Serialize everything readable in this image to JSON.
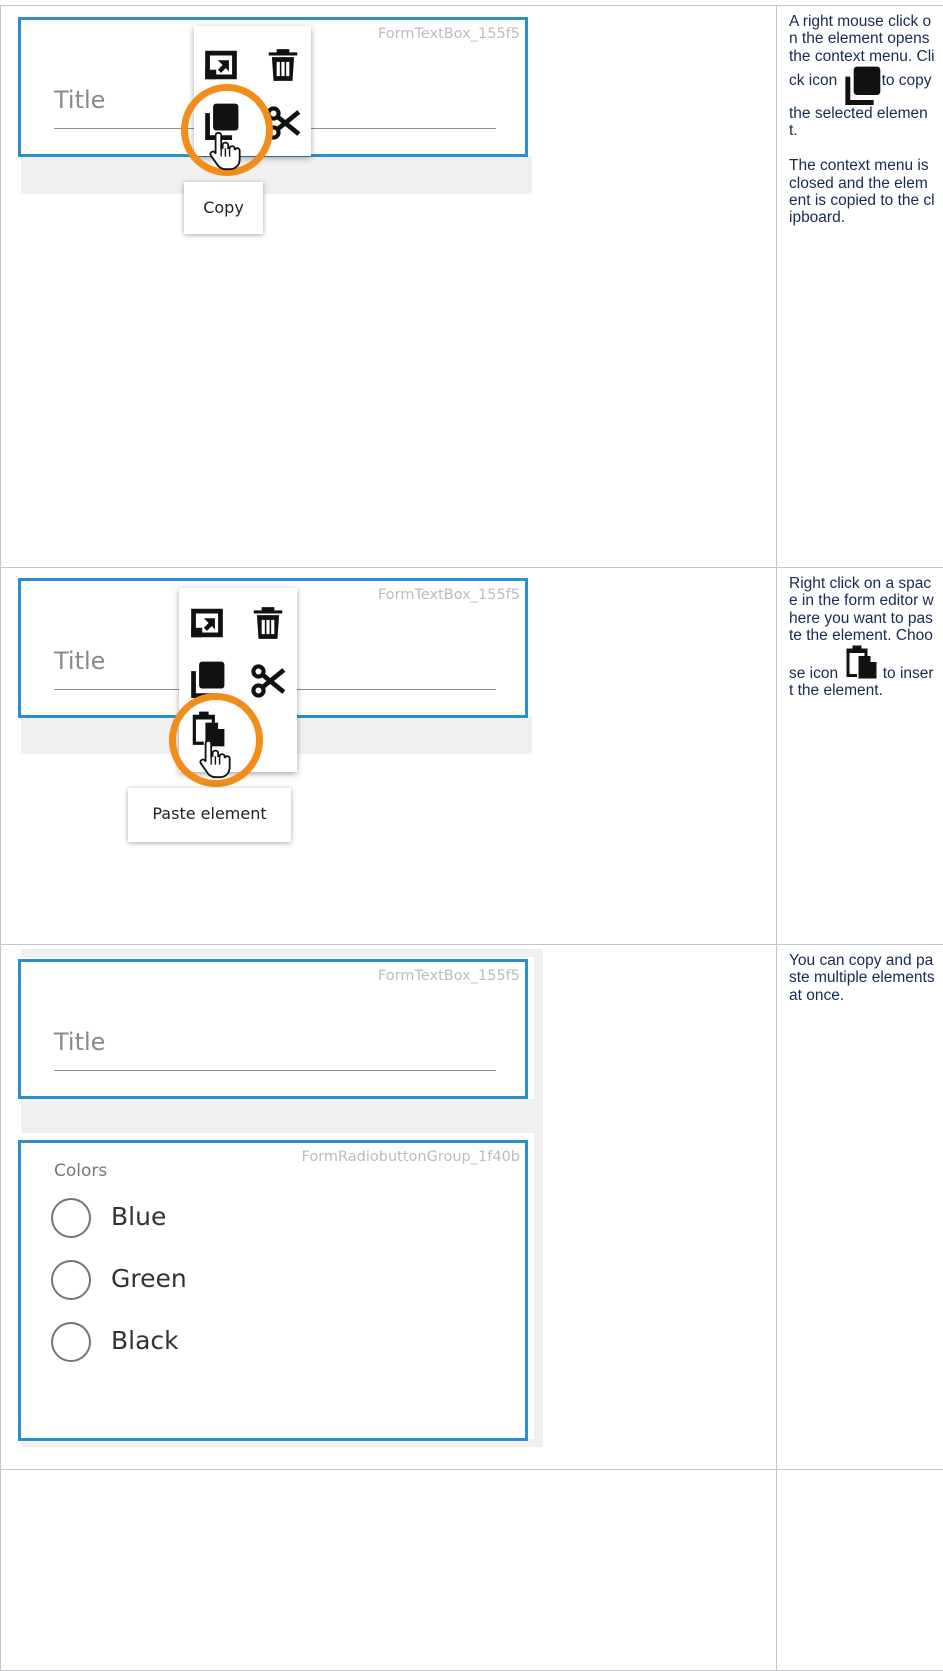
{
  "rows": [
    {
      "screenshot": {
        "component_id": "FormTextBox_155f5",
        "field_label": "Title",
        "tooltip": "Copy"
      },
      "description": {
        "p1_before_icon": "A right mouse click on the element opens the context menu. Click icon",
        "p1_after_icon": "to copy the selected element.",
        "p2": "The context menu is closed and the element is copied to the clipboard."
      }
    },
    {
      "screenshot": {
        "component_id": "FormTextBox_155f5",
        "field_label": "Title",
        "tooltip": "Paste element"
      },
      "description": {
        "p1_before_icon": "Right click on a space in the form editor where you want to paste the element. Choose icon",
        "p1_after_icon": "to insert the element."
      }
    },
    {
      "screenshot": {
        "textbox_id": "FormTextBox_155f5",
        "field_label": "Title",
        "radio_group_id": "FormRadiobuttonGroup_1f40b",
        "radio_group_label": "Colors",
        "options": [
          "Blue",
          "Green",
          "Black"
        ]
      },
      "description": {
        "p1": "You can copy and paste multiple elements at once."
      }
    },
    {
      "screenshot": {},
      "description": {}
    }
  ],
  "icons": [
    "resize-icon",
    "trash-icon",
    "copy-icon",
    "cut-icon",
    "paste-icon",
    "hand-cursor-icon"
  ],
  "colors": {
    "selection_border": "#2e8ec9",
    "highlight_ring": "#f28c1b",
    "table_border": "#c1c7d0"
  }
}
